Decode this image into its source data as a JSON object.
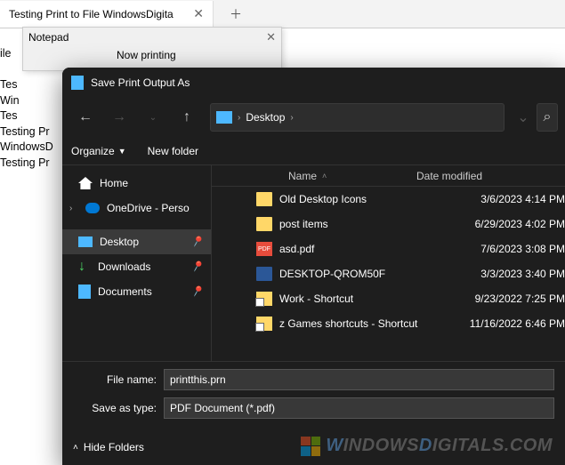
{
  "tab": {
    "label": "Testing Print to File WindowsDigita"
  },
  "now_printing": {
    "title": "Notepad",
    "status": "Now printing"
  },
  "bg_text": "ile\n\nTes\nWin\nTes\nTesting Pr\nWindowsD\nTesting Pr",
  "dialog": {
    "title": "Save Print Output As",
    "address": {
      "crumb": "Desktop"
    },
    "toolbar": {
      "organize": "Organize",
      "new_folder": "New folder"
    },
    "nav": {
      "home": "Home",
      "onedrive": "OneDrive - Perso",
      "desktop": "Desktop",
      "downloads": "Downloads",
      "documents": "Documents"
    },
    "columns": {
      "name": "Name",
      "date": "Date modified"
    },
    "files": [
      {
        "icon": "folder",
        "name": "Old Desktop Icons",
        "date": "3/6/2023 4:14 PM"
      },
      {
        "icon": "folder",
        "name": "post items",
        "date": "6/29/2023 4:02 PM"
      },
      {
        "icon": "pdf",
        "name": "asd.pdf",
        "date": "7/6/2023 3:08 PM"
      },
      {
        "icon": "pc",
        "name": "DESKTOP-QROM50F",
        "date": "3/3/2023 3:40 PM"
      },
      {
        "icon": "shortcut",
        "name": "Work - Shortcut",
        "date": "9/23/2022 7:25 PM"
      },
      {
        "icon": "shortcut",
        "name": "z Games shortcuts - Shortcut",
        "date": "11/16/2022 6:46 PM"
      }
    ],
    "inputs": {
      "filename_label": "File name:",
      "filename_value": "printthis.prn",
      "type_label": "Save as type:",
      "type_value": "PDF Document (*.pdf)"
    },
    "footer": {
      "hide_folders": "Hide Folders"
    }
  },
  "watermark": {
    "text_a": "W",
    "text_b": "INDOWS",
    "text_c": "D",
    "text_d": "IGITALS.COM"
  }
}
